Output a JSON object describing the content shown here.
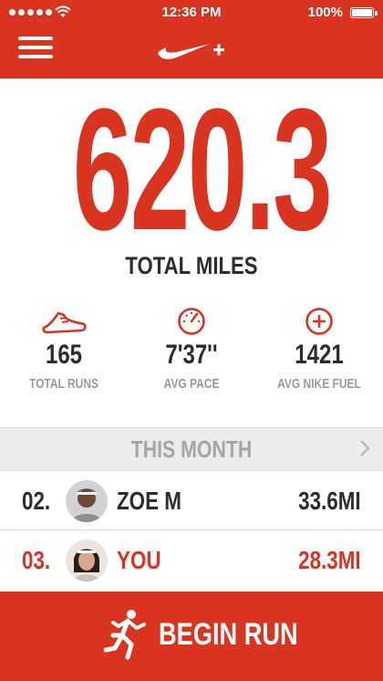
{
  "status_bar": {
    "time": "12:36 PM",
    "battery": "100%"
  },
  "colors": {
    "brand": "#d8341f",
    "text_dark": "#2d2d2d",
    "text_muted": "#9a9a9a",
    "bar_bg": "#ececec"
  },
  "icons": {
    "menu": "hamburger-menu-icon",
    "logo": "nike-plus-logo",
    "runs": "running-shoe-icon",
    "pace": "speedometer-icon",
    "fuel": "plus-circle-icon",
    "chevron": "chevron-right-icon",
    "runner": "runner-icon"
  },
  "summary": {
    "total_miles": "620.3",
    "total_miles_label": "TOTAL MILES"
  },
  "stats": [
    {
      "value": "165",
      "label": "TOTAL RUNS"
    },
    {
      "value": "7'37''",
      "label": "AVG PACE"
    },
    {
      "value": "1421",
      "label": "AVG NIKE FUEL"
    }
  ],
  "leaderboard": {
    "title": "THIS MONTH",
    "rows": [
      {
        "rank": "02.",
        "name": "ZOE M",
        "distance": "33.6MI"
      },
      {
        "rank": "03.",
        "name": "YOU",
        "distance": "28.3MI"
      }
    ]
  },
  "cta": {
    "label": "BEGIN RUN"
  }
}
